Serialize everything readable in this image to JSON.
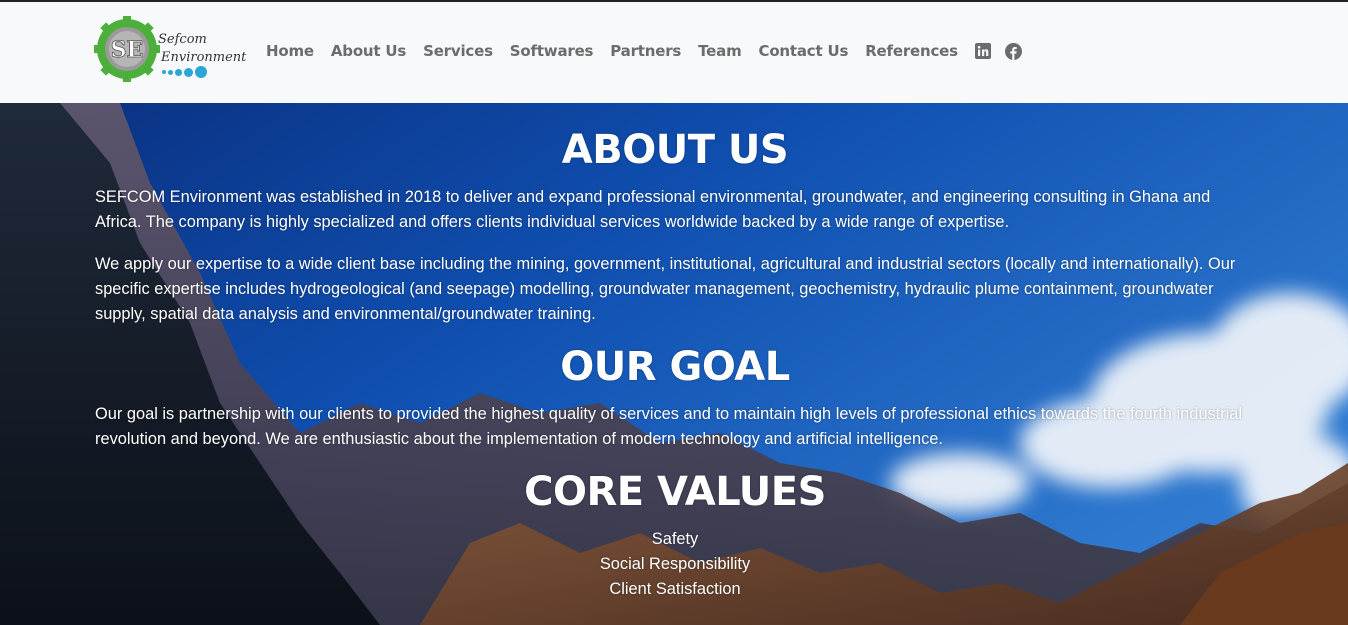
{
  "brand": {
    "logo_mark": "SE",
    "name_line1": "Sefcom",
    "name_line2": "Environment"
  },
  "nav": {
    "items": [
      {
        "label": "Home"
      },
      {
        "label": "About Us"
      },
      {
        "label": "Services"
      },
      {
        "label": "Softwares"
      },
      {
        "label": "Partners"
      },
      {
        "label": "Team"
      },
      {
        "label": "Contact Us"
      },
      {
        "label": "References"
      }
    ],
    "social": [
      {
        "icon": "linkedin-icon"
      },
      {
        "icon": "facebook-icon"
      }
    ]
  },
  "about": {
    "heading": "ABOUT US",
    "paragraph1": "SEFCOM Environment was established in 2018 to deliver and expand professional environmental, groundwater, and engineering consulting in Ghana and Africa. The company is highly specialized and offers clients individual services worldwide backed by a wide range of expertise.",
    "paragraph2": "We apply our expertise to a wide client base including the mining, government, institutional, agricultural and industrial sectors (locally and internationally). Our specific expertise includes hydrogeological (and seepage) modelling, groundwater management, geochemistry, hydraulic plume containment, groundwater supply, spatial data analysis and environmental/groundwater training."
  },
  "goal": {
    "heading": "OUR GOAL",
    "paragraph": "Our goal is partnership with our clients to provided the highest quality of services and to maintain high levels of professional ethics towards the fourth industrial revolution and beyond. We are enthusiastic about the implementation of modern technology and artificial intelligence."
  },
  "core_values": {
    "heading": "CORE VALUES",
    "items": [
      "Safety",
      "Social Responsibility",
      "Client Satisfaction"
    ]
  },
  "colors": {
    "navbar_bg": "#f8f9fa",
    "nav_text": "#6c6c6c",
    "logo_green": "#4caf3c",
    "logo_blue": "#2aa5d6",
    "hero_text": "#ffffff"
  }
}
